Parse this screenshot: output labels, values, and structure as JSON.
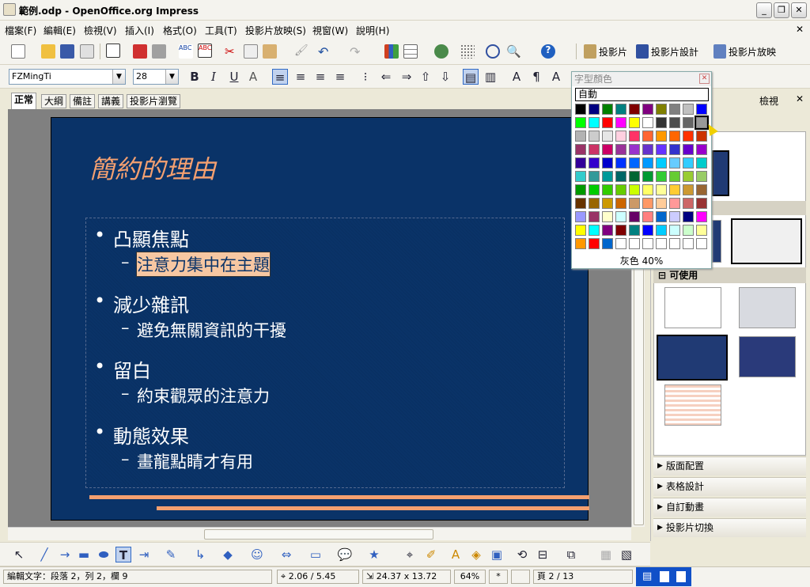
{
  "window": {
    "title": "範例.odp - OpenOffice.org Impress"
  },
  "menu": [
    "檔案(F)",
    "編輯(E)",
    "檢視(V)",
    "插入(I)",
    "格式(O)",
    "工具(T)",
    "投影片放映(S)",
    "視窗(W)",
    "說明(H)"
  ],
  "toolbar_right": {
    "slide": "投影片",
    "slide_design": "投影片設計",
    "slideshow": "投影片放映"
  },
  "format": {
    "font": "FZMingTi",
    "size": "28",
    "bold": "B",
    "italic": "I",
    "underline": "U"
  },
  "view_tabs": [
    "正常",
    "大綱",
    "備註",
    "講義",
    "投影片瀏覽"
  ],
  "slide": {
    "title": "簡約的理由",
    "bullets": [
      {
        "main": "凸顯焦點",
        "sub": "注意力集中在主題"
      },
      {
        "main": "減少雜訊",
        "sub": "避免無關資訊的干擾"
      },
      {
        "main": "留白",
        "sub": "約束觀眾的注意力"
      },
      {
        "main": "動態效果",
        "sub": "畫龍點睛才有用"
      }
    ]
  },
  "palette": {
    "title": "字型顏色",
    "auto": "自動",
    "selected_name": "灰色 40%",
    "rows": [
      [
        "#000000",
        "#000080",
        "#008000",
        "#008080",
        "#800000",
        "#800080",
        "#808000",
        "#808080",
        "#c0c0c0",
        "#0000ff"
      ],
      [
        "#00ff00",
        "#00ffff",
        "#ff0000",
        "#ff00ff",
        "#ffff00",
        "#ffffff",
        "#333333",
        "#4d4d4d",
        "#666666",
        "#999999"
      ],
      [
        "#b3b3b3",
        "#cccccc",
        "#e6e6e6",
        "#ffd0e0",
        "#ff3366",
        "#ff6633",
        "#ff9900",
        "#ff6600",
        "#ff3300",
        "#cc3300"
      ],
      [
        "#993366",
        "#cc3366",
        "#cc0066",
        "#993399",
        "#9933cc",
        "#6633cc",
        "#6633ff",
        "#3333cc",
        "#6600cc",
        "#9900cc"
      ],
      [
        "#330099",
        "#3300cc",
        "#0000cc",
        "#0033ff",
        "#0066ff",
        "#0099ff",
        "#00ccff",
        "#66ccff",
        "#33ccff",
        "#00cccc"
      ],
      [
        "#33cccc",
        "#339999",
        "#009999",
        "#006666",
        "#006633",
        "#009933",
        "#33cc33",
        "#66cc33",
        "#99cc33",
        "#99cc66"
      ],
      [
        "#009900",
        "#00cc00",
        "#33cc00",
        "#66cc00",
        "#ccff00",
        "#ffff66",
        "#ffff99",
        "#ffcc33",
        "#cc9933",
        "#996633"
      ],
      [
        "#663300",
        "#996600",
        "#cc9900",
        "#cc6600",
        "#cc9966",
        "#ff9966",
        "#ffcc99",
        "#ff9999",
        "#cc6666",
        "#993333"
      ],
      [
        "#9999ff",
        "#993366",
        "#ffffcc",
        "#ccffff",
        "#660066",
        "#ff8080",
        "#0066cc",
        "#ccccff",
        "#000080",
        "#ff00ff"
      ],
      [
        "#ffff00",
        "#00ffff",
        "#800080",
        "#800000",
        "#008080",
        "#0000ff",
        "#00ccff",
        "#ccffff",
        "#ccffcc",
        "#ffff99"
      ],
      [
        "#ff9900",
        "#ff0000",
        "#0066cc",
        "#ffffff",
        "#ffffff",
        "#ffffff",
        "#ffffff",
        "#ffffff",
        "#ffffff",
        "#ffffff"
      ]
    ]
  },
  "task_pane": {
    "view_label": "檢視",
    "section_available": "可使用",
    "bars": [
      "版面配置",
      "表格設計",
      "自訂動畫",
      "投影片切換"
    ]
  },
  "status": {
    "edit": "編輯文字：段落 2，列 2，欄 9",
    "position": "2.06 / 5.45",
    "size": "24.37 x 13.72",
    "zoom": "64%",
    "modified": "*",
    "page": "頁 2 / 13"
  }
}
